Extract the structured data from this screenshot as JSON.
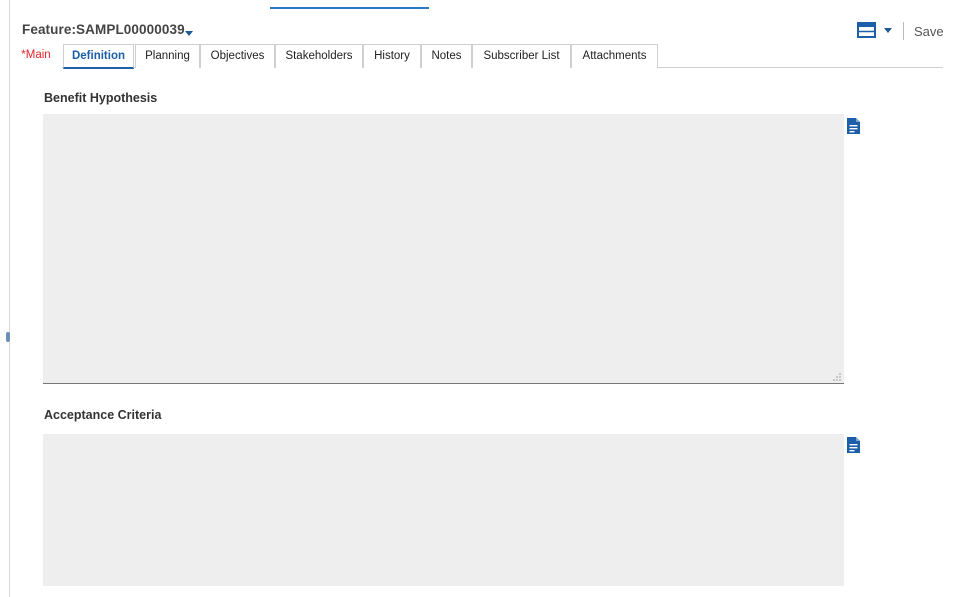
{
  "header": {
    "record_title": "Feature:SAMPL00000039",
    "title_menu_icon": "chevron-down-icon",
    "layout_icon": "layout-grid-icon",
    "layout_menu_icon": "chevron-down-icon",
    "save_label": "Save"
  },
  "tabs": [
    {
      "label": "*Main",
      "state": "required"
    },
    {
      "label": "Definition",
      "state": "active"
    },
    {
      "label": "Planning",
      "state": "normal"
    },
    {
      "label": "Objectives",
      "state": "normal"
    },
    {
      "label": "Stakeholders",
      "state": "normal"
    },
    {
      "label": "History",
      "state": "normal"
    },
    {
      "label": "Notes",
      "state": "normal"
    },
    {
      "label": "Subscriber List",
      "state": "normal"
    },
    {
      "label": "Attachments",
      "state": "normal"
    }
  ],
  "fields": {
    "benefit_hypothesis": {
      "label": "Benefit Hypothesis",
      "value": "",
      "icon": "document-icon"
    },
    "acceptance_criteria": {
      "label": "Acceptance Criteria",
      "value": "",
      "icon": "document-icon"
    }
  },
  "colors": {
    "accent": "#1c5fa8",
    "required": "#e0262d",
    "field_background": "#eeeeee"
  }
}
